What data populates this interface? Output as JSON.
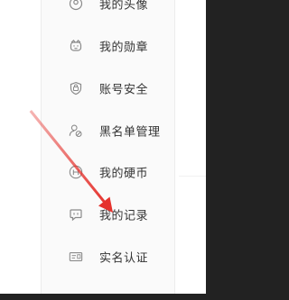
{
  "menu": {
    "items": [
      {
        "label": "我的头像",
        "icon": "avatar-icon"
      },
      {
        "label": "我的勋章",
        "icon": "medal-icon"
      },
      {
        "label": "账号安全",
        "icon": "shield-icon"
      },
      {
        "label": "黑名单管理",
        "icon": "blacklist-user-icon"
      },
      {
        "label": "我的硬币",
        "icon": "coin-icon"
      },
      {
        "label": "我的记录",
        "icon": "record-icon"
      },
      {
        "label": "实名认证",
        "icon": "id-card-icon"
      }
    ]
  },
  "annotation": {
    "arrow_color": "#e5322d"
  }
}
